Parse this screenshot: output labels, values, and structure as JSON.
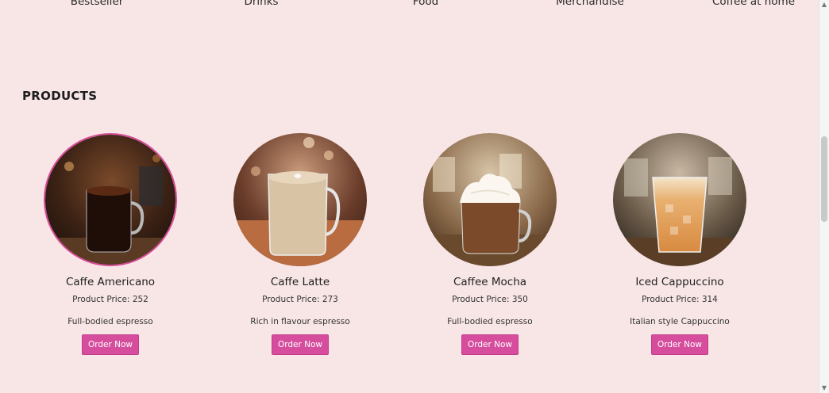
{
  "nav": {
    "items": [
      "Bestseller",
      "Drinks",
      "Food",
      "Merchandise",
      "Coffee at home"
    ]
  },
  "section": {
    "title": "PRODUCTS"
  },
  "products": [
    {
      "name": "Caffe Americano",
      "price": "Product Price: 252",
      "desc": "Full-bodied espresso",
      "button": "Order Now",
      "image": "americano-mug-image",
      "selected": true
    },
    {
      "name": "Caffe Latte",
      "price": "Product Price: 273",
      "desc": "Rich in flavour espresso",
      "button": "Order Now",
      "image": "latte-glass-image",
      "selected": false
    },
    {
      "name": "Caffee Mocha",
      "price": "Product Price: 350",
      "desc": "Full-bodied espresso",
      "button": "Order Now",
      "image": "mocha-whipped-cream-image",
      "selected": false
    },
    {
      "name": "Iced Cappuccino",
      "price": "Product Price: 314",
      "desc": "Italian style Cappuccino",
      "button": "Order Now",
      "image": "iced-cappuccino-image",
      "selected": false
    }
  ],
  "colors": {
    "background": "#f8e6e6",
    "accent": "#d64d9e"
  }
}
